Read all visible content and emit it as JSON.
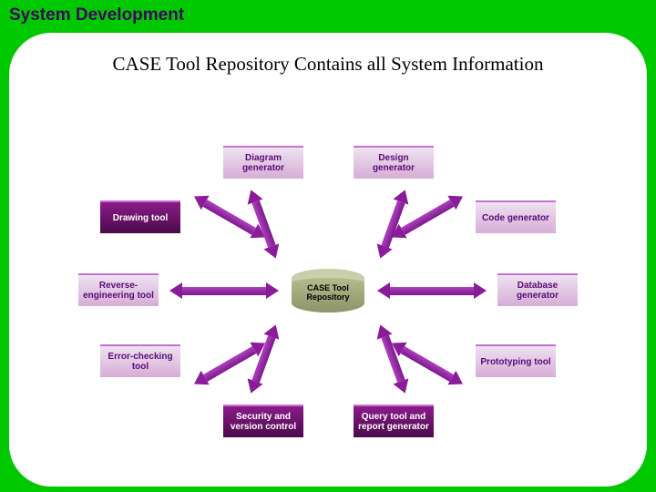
{
  "page": {
    "title": "System Development",
    "subtitle": "CASE Tool Repository Contains all System Information"
  },
  "center": {
    "label": "CASE Tool Repository"
  },
  "boxes": {
    "diagram_generator": "Diagram generator",
    "design_generator": "Design generator",
    "drawing_tool": "Drawing tool",
    "code_generator": "Code generator",
    "reverse_engineering_tool": "Reverse-engineering tool",
    "database_generator": "Database generator",
    "error_checking_tool": "Error-checking tool",
    "prototyping_tool": "Prototyping tool",
    "security_version_control": "Security and version control",
    "query_report_generator": "Query tool and report generator"
  }
}
